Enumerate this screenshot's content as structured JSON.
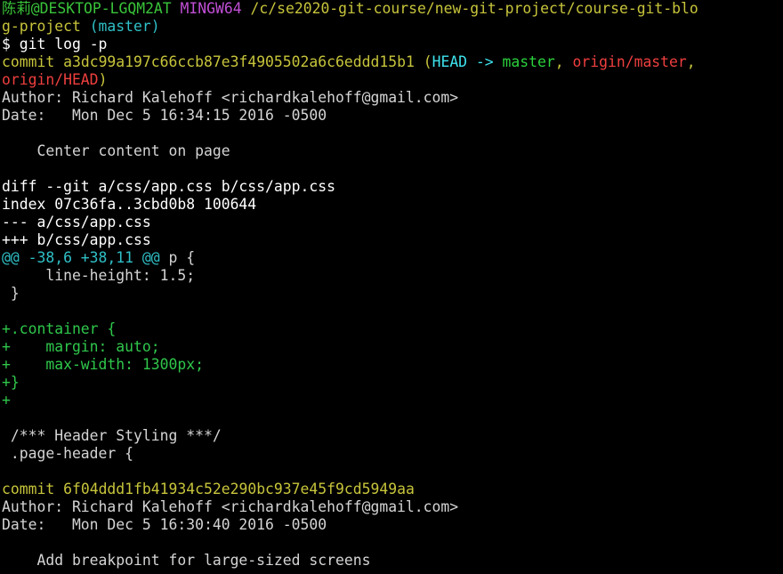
{
  "colors": {
    "background": "#000000",
    "text": "#d4d4d4",
    "user_host": "#39c43a",
    "mingw": "#c14fd6",
    "path": "#c7c43b",
    "branch": "#2fc0c7",
    "commit": "#c7c43b",
    "head": "#3ee3ee",
    "local_branch": "#2bd13d",
    "remote_branch": "#ef3f3f",
    "hunk": "#2fc0c7",
    "added": "#2fc74b"
  },
  "prompt": {
    "user_host": "陈莉@DESKTOP-LGQM2AT",
    "shell": "MINGW64",
    "path": "/c/se2020-git-course/new-git-project/course-git-blo",
    "path_wrap": "g-project",
    "branch": "(master)",
    "symbol": "$",
    "command": "git log -p"
  },
  "commit1": {
    "label": "commit",
    "hash": "a3dc99a197c66ccb87e3f4905502a6c6eddd15b1",
    "ref_open": "(",
    "head": "HEAD ->",
    "local_branch": "master",
    "sep1": ",",
    "remote1": "origin/master",
    "sep2": ",",
    "remote2": "origin/HEAD",
    "ref_close": ")",
    "author": "Author: Richard Kalehoff <richardkalehoff@gmail.com>",
    "date": "Date:   Mon Dec 5 16:34:15 2016 -0500",
    "message": "    Center content on page"
  },
  "diff": {
    "header": "diff --git a/css/app.css b/css/app.css",
    "index": "index 07c36fa..3cbd0b8 100644",
    "old_file": "--- a/css/app.css",
    "new_file": "+++ b/css/app.css",
    "hunk_marker": "@@ -38,6 +38,11 @@",
    "hunk_context": " p {",
    "lines": {
      "l1": "     line-height: 1.5;",
      "l2": " }",
      "l3": "",
      "a1": "+.container {",
      "a2": "+    margin: auto;",
      "a3": "+    max-width: 1300px;",
      "a4": "+}",
      "a5": "+",
      "l4": "",
      "l5": " /*** Header Styling ***/",
      "l6": " .page-header {",
      "l7": ""
    }
  },
  "commit2": {
    "label": "commit",
    "hash": "6f04ddd1fb41934c52e290bc937e45f9cd5949aa",
    "author": "Author: Richard Kalehoff <richardkalehoff@gmail.com>",
    "date": "Date:   Mon Dec 5 16:30:40 2016 -0500",
    "blank": "",
    "message": "    Add breakpoint for large-sized screens"
  }
}
